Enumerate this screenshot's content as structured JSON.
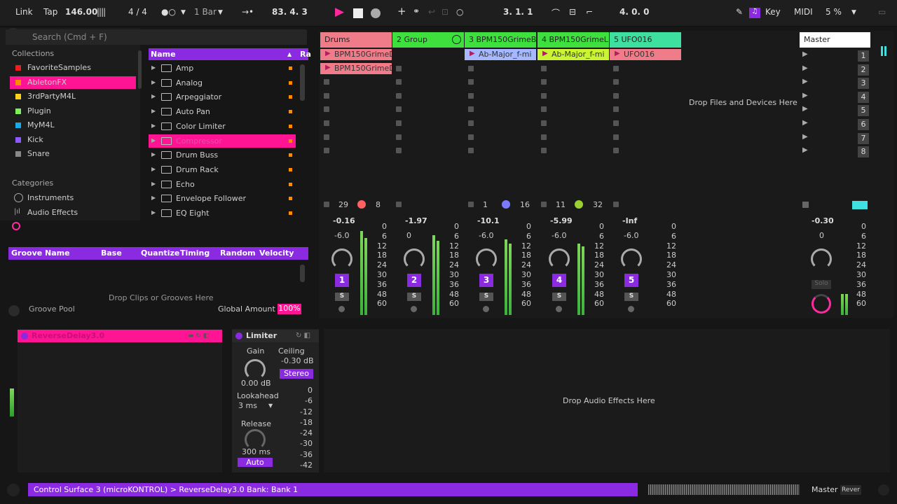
{
  "toolbar": {
    "link": "Link",
    "tap": "Tap",
    "tempo": "146.00",
    "signature": "4 / 4",
    "quantize": "1 Bar",
    "position": "83.  4.  3",
    "loop_start": "3.  1.  1",
    "loop_length": "4.  0.  0",
    "key": "Key",
    "midi": "MIDI",
    "cpu": "5 %"
  },
  "browser": {
    "search_placeholder": "Search (Cmd + F)",
    "collections_title": "Collections",
    "collections": [
      {
        "label": "FavoriteSamples",
        "color": "#e8201e"
      },
      {
        "label": "AbletonFX",
        "color": "#ff8c00"
      },
      {
        "label": "3rdPartyM4L",
        "color": "#ffd21f"
      },
      {
        "label": "Plugin",
        "color": "#7cf05a"
      },
      {
        "label": "MyM4L",
        "color": "#19a9e6"
      },
      {
        "label": "Kick",
        "color": "#8c5aff"
      },
      {
        "label": "Snare",
        "color": "#888888"
      }
    ],
    "categories_title": "Categories",
    "categories": [
      "Instruments",
      "Audio Effects"
    ],
    "col_name": "Name",
    "col_ra": "Ra",
    "items": [
      "Amp",
      "Analog",
      "Arpeggiator",
      "Auto Pan",
      "Color Limiter",
      "Compressor",
      "Drum Buss",
      "Drum Rack",
      "Echo",
      "Envelope Follower",
      "EQ Eight"
    ]
  },
  "groove": {
    "headers": [
      "Groove Name",
      "Base",
      "Quantize",
      "Timing",
      "Random",
      "Velocity"
    ],
    "drop_hint": "Drop Clips or Grooves Here",
    "pool": "Groove Pool",
    "global_amount_label": "Global Amount",
    "global_amount": "100%"
  },
  "tracks": [
    {
      "name": "Drums",
      "color": "#f07c8a",
      "clips": [
        "BPM150GrimeD",
        "BPM150GrimeD"
      ],
      "vol": "-0.16",
      "pan": "-6.0",
      "num": "1",
      "a": "29",
      "b": "8"
    },
    {
      "name": "2 Group",
      "color": "#3ee03e",
      "clips": [],
      "vol": "-1.97",
      "pan": "0",
      "num": "2",
      "a": "",
      "b": ""
    },
    {
      "name": "3 BPM150GrimeB",
      "color": "#3ee03e",
      "clips": [
        "Ab-Major_f-mi"
      ],
      "vol": "-10.1",
      "pan": "-6.0",
      "num": "3",
      "a": "1",
      "b": "16"
    },
    {
      "name": "4 BPM150GrimeL",
      "color": "#3ee03e",
      "clips": [
        "Ab-Major_f-mi"
      ],
      "vol": "-5.99",
      "pan": "-6.0",
      "num": "4",
      "a": "11",
      "b": "32"
    },
    {
      "name": "5 UFO016",
      "color": "#3ee0a0",
      "clips": [
        "UFO016"
      ],
      "vol": "-Inf",
      "pan": "-6.0",
      "num": "5",
      "a": "",
      "b": ""
    }
  ],
  "master": {
    "name": "Master",
    "vol": "-0.30",
    "pan": "0",
    "scenes": [
      "1",
      "2",
      "3",
      "4",
      "5",
      "6",
      "7",
      "8"
    ],
    "solo": "Solo"
  },
  "drop_files": "Drop Files and Devices Here",
  "meter_scale": [
    "0",
    "6",
    "12",
    "18",
    "24",
    "30",
    "36",
    "48",
    "60"
  ],
  "solo_label": "S",
  "devices": {
    "reverse_delay": "ReverseDelay3.0",
    "limiter": "Limiter",
    "gain_label": "Gain",
    "gain_value": "0.00 dB",
    "ceiling_label": "Ceiling",
    "ceiling_value": "-0.30 dB",
    "stereo": "Stereo",
    "lookahead_label": "Lookahead",
    "lookahead_value": "3 ms",
    "release_label": "Release",
    "release_value": "300 ms",
    "auto": "Auto",
    "scale": [
      "0",
      "-6",
      "-12",
      "-18",
      "-24",
      "-30",
      "-36",
      "-42"
    ],
    "drop_hint": "Drop Audio Effects Here"
  },
  "status": {
    "text": "Control Surface 3 (microKONTROL) > ReverseDelay3.0 Bank: Bank 1",
    "track": "Master",
    "device": "Rever"
  }
}
